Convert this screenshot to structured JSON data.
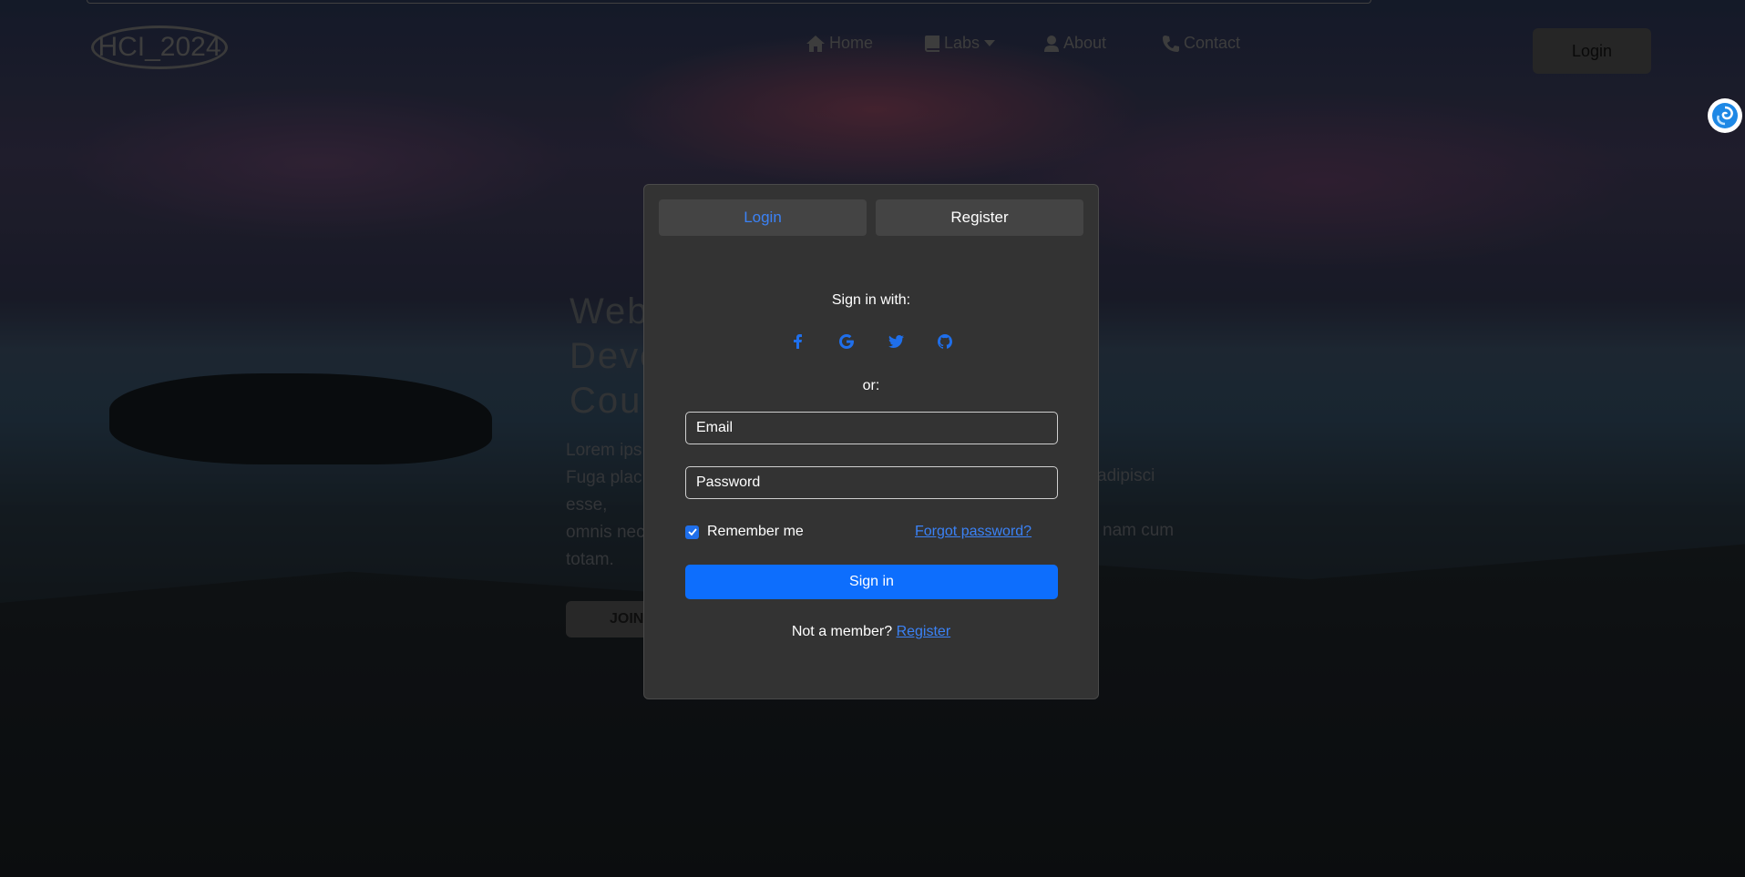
{
  "navbar": {
    "logo": "HCI_2024",
    "home": "Home",
    "labs": "Labs",
    "about": "About",
    "contact": "Contact",
    "login": "Login"
  },
  "hero": {
    "title_lines": [
      "Web",
      "Deve",
      "Cou"
    ],
    "text_lines": [
      "Lorem ips",
      "Fuga plac",
      "esse,",
      "omnis nec",
      "totam."
    ],
    "text_right": [
      "adipisci",
      "nam cum"
    ],
    "join": "JOIN"
  },
  "modal": {
    "tabs": {
      "login": "Login",
      "register": "Register"
    },
    "sign_in_with": "Sign in with:",
    "or": "or:",
    "email_placeholder": "Email",
    "password_placeholder": "Password",
    "remember_me": "Remember me",
    "forgot_password": "Forgot password?",
    "sign_in": "Sign in",
    "not_member": "Not a member?",
    "register_link": "Register"
  },
  "colors": {
    "accent": "#0d6efd",
    "modal_bg": "#333333",
    "tab_bg": "#444444"
  }
}
